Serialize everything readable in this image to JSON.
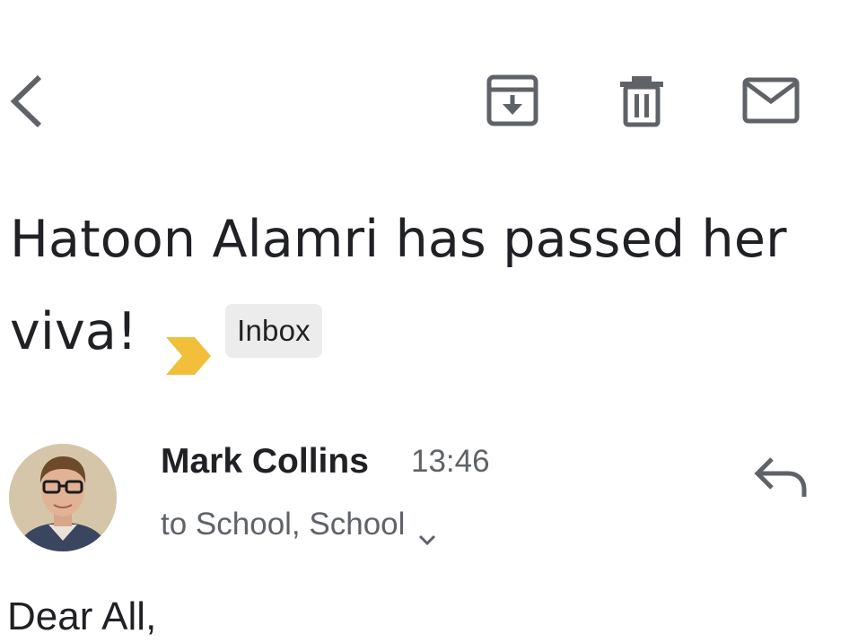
{
  "toolbar": {
    "back_icon": "chevron-left-icon",
    "archive_icon": "archive-icon",
    "delete_icon": "trash-icon",
    "mark_unread_icon": "mail-icon"
  },
  "email": {
    "subject": "Hatoon Alamri has passed her viva!",
    "importance_icon": "importance-marker-icon",
    "importance_color": "#F2BF3B",
    "label": "Inbox",
    "sender": {
      "name": "Mark Collins",
      "time": "13:46",
      "recipients": "to School, School",
      "avatar": "avatar-photo"
    },
    "reply_icon": "reply-icon",
    "body_start": "Dear All,"
  },
  "colors": {
    "text_primary": "#202124",
    "text_secondary": "#5f6368",
    "icon": "#5f6368",
    "chip_bg": "#ececec"
  }
}
